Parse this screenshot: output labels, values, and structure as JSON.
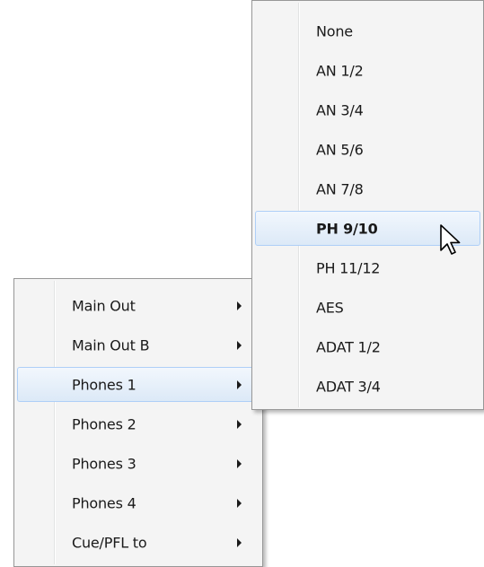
{
  "main_menu": {
    "items": [
      {
        "label": "Main Out",
        "has_submenu": true,
        "highlighted": false
      },
      {
        "label": "Main Out B",
        "has_submenu": true,
        "highlighted": false
      },
      {
        "label": "Phones 1",
        "has_submenu": true,
        "highlighted": true
      },
      {
        "label": "Phones 2",
        "has_submenu": true,
        "highlighted": false
      },
      {
        "label": "Phones 3",
        "has_submenu": true,
        "highlighted": false
      },
      {
        "label": "Phones 4",
        "has_submenu": true,
        "highlighted": false
      },
      {
        "label": "Cue/PFL to",
        "has_submenu": true,
        "highlighted": false
      }
    ]
  },
  "submenu": {
    "items": [
      {
        "label": "None",
        "highlighted": false,
        "bold": false
      },
      {
        "label": "AN 1/2",
        "highlighted": false,
        "bold": false
      },
      {
        "label": "AN 3/4",
        "highlighted": false,
        "bold": false
      },
      {
        "label": "AN 5/6",
        "highlighted": false,
        "bold": false
      },
      {
        "label": "AN 7/8",
        "highlighted": false,
        "bold": false
      },
      {
        "label": "PH 9/10",
        "highlighted": true,
        "bold": true
      },
      {
        "label": "PH 11/12",
        "highlighted": false,
        "bold": false
      },
      {
        "label": "AES",
        "highlighted": false,
        "bold": false
      },
      {
        "label": "ADAT 1/2",
        "highlighted": false,
        "bold": false
      },
      {
        "label": "ADAT 3/4",
        "highlighted": false,
        "bold": false
      }
    ]
  },
  "icons": {
    "submenu_arrow": "chevron-right-icon",
    "cursor": "mouse-pointer-icon"
  },
  "colors": {
    "menu_background": "#f4f4f4",
    "menu_border": "#979797",
    "highlight_border": "#aecff7",
    "highlight_top": "#f2f7fd",
    "highlight_bottom": "#dce9f7"
  }
}
